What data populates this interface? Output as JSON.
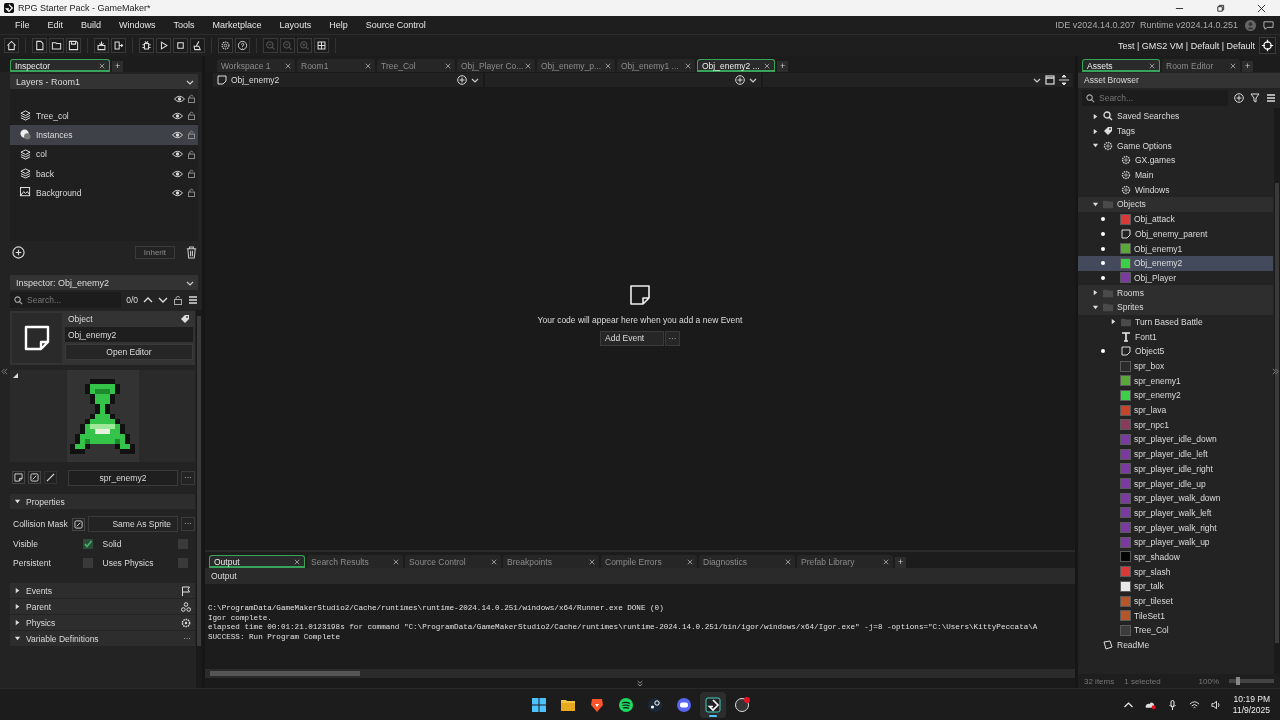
{
  "window": {
    "title": "RPG Starter Pack - GameMaker*"
  },
  "menu": [
    "File",
    "Edit",
    "Build",
    "Windows",
    "Tools",
    "Marketplace",
    "Layouts",
    "Help",
    "Source Control"
  ],
  "ide_version": "IDE v2024.14.0.207",
  "runtime_version": "Runtime v2024.14.0.251",
  "toolbar": [
    [
      {
        "kind": "home",
        "disabled": false
      }
    ],
    [
      {
        "kind": "new",
        "disabled": false
      },
      {
        "kind": "open",
        "disabled": false
      },
      {
        "kind": "save",
        "disabled": false
      }
    ],
    [
      {
        "kind": "package",
        "disabled": false
      },
      {
        "kind": "export",
        "disabled": false
      }
    ],
    [
      {
        "kind": "debug",
        "disabled": false
      },
      {
        "kind": "run",
        "disabled": false
      },
      {
        "kind": "stop",
        "disabled": false
      },
      {
        "kind": "clean",
        "disabled": false
      }
    ],
    [
      {
        "kind": "settings",
        "disabled": false
      },
      {
        "kind": "help",
        "disabled": false
      }
    ],
    [
      {
        "kind": "zoom-out",
        "disabled": true
      },
      {
        "kind": "zoom-reset",
        "disabled": true
      },
      {
        "kind": "zoom-in",
        "disabled": true
      },
      {
        "kind": "grid",
        "disabled": false
      }
    ]
  ],
  "target": "Test | GMS2 VM | Default | Default",
  "inspector": {
    "tabs": [
      {
        "label": "Inspector",
        "selected": true
      }
    ],
    "add_tab": "+",
    "layers_dropdown": "Layers - Room1",
    "layers": [
      {
        "name": "Tree_col",
        "kind": "tiles",
        "selected": false,
        "visible": true
      },
      {
        "name": "Instances",
        "kind": "instances",
        "selected": true,
        "visible": true
      },
      {
        "name": "col",
        "kind": "tiles",
        "selected": false,
        "visible": true
      },
      {
        "name": "back",
        "kind": "tiles",
        "selected": false,
        "visible": true
      },
      {
        "name": "Background",
        "kind": "background",
        "selected": false,
        "visible": true
      }
    ],
    "inherit_button": {
      "label": "Inherit",
      "disabled": true
    },
    "inspector_dropdown": "Inspector: Obj_enemy2",
    "search": {
      "placeholder": "Search..."
    },
    "match_count": "0/0",
    "object": {
      "type_label": "Object",
      "name": "Obj_enemy2",
      "open_button": "Open Editor"
    },
    "sprite_name": "spr_enemy2",
    "sprite_more": "···",
    "properties": {
      "title": "Properties",
      "expanded": true
    },
    "collision_mask": {
      "label": "Collision Mask",
      "value": "Same As Sprite",
      "more": "···"
    },
    "checkboxes": [
      {
        "label": "Visible",
        "checked": true
      },
      {
        "label": "Solid",
        "checked": false
      },
      {
        "label": "Persistent",
        "checked": false
      },
      {
        "label": "Uses Physics",
        "checked": false
      }
    ],
    "sections": [
      {
        "title": "Events",
        "expanded": false,
        "kind": "flag"
      },
      {
        "title": "Parent",
        "expanded": false,
        "kind": "parent"
      },
      {
        "title": "Physics",
        "expanded": false,
        "kind": "physics"
      },
      {
        "title": "Variable Definitions",
        "expanded": true,
        "kind": "more",
        "more": "···"
      }
    ]
  },
  "editor": {
    "tabs": [
      {
        "label": "Workspace 1",
        "selected": false
      },
      {
        "label": "Room1",
        "selected": false
      },
      {
        "label": "Tree_Col",
        "selected": false
      },
      {
        "label": "Obj_Player Co...",
        "selected": false
      },
      {
        "label": "Obj_enemy_p...",
        "selected": false
      },
      {
        "label": "Obj_enemy1 ...",
        "selected": false
      },
      {
        "label": "Obj_enemy2 ...",
        "selected": true
      }
    ],
    "add_tab": "+",
    "breadcrumb": "Obj_enemy2",
    "empty_message": "Your code will appear here when you add a new Event",
    "add_event": "Add Event",
    "add_event_more": "···"
  },
  "output": {
    "tabs": [
      {
        "label": "Output",
        "selected": true
      },
      {
        "label": "Search Results",
        "selected": false
      },
      {
        "label": "Source Control",
        "selected": false
      },
      {
        "label": "Breakpoints",
        "selected": false
      },
      {
        "label": "Compile Errors",
        "selected": false
      },
      {
        "label": "Diagnostics",
        "selected": false
      },
      {
        "label": "Prefab Library",
        "selected": false
      }
    ],
    "add_tab": "+",
    "header": "Output",
    "lines": [
      "C:\\ProgramData/GameMakerStudio2/Cache/runtimes\\runtime-2024.14.0.251/windows/x64/Runner.exe DONE (0)",
      "Igor complete.",
      "elapsed time 00:01:21.0123198s for command \"C:\\ProgramData/GameMakerStudio2/Cache/runtimes\\runtime-2024.14.0.251/bin/igor/windows/x64/Igor.exe\" -j=8  -options=\"C:\\Users\\KittyPeccata\\A",
      "SUCCESS: Run Program Complete"
    ]
  },
  "assets": {
    "tabs": [
      {
        "label": "Assets",
        "selected": true
      },
      {
        "label": "Room Editor",
        "selected": false
      }
    ],
    "add_tab": "+",
    "header": "Asset Browser",
    "search": {
      "placeholder": "Search..."
    },
    "tree": [
      {
        "label": "Saved Searches",
        "kind": "search",
        "expanded": false,
        "selected": false,
        "dot": false
      },
      {
        "label": "Tags",
        "kind": "tag",
        "expanded": false,
        "selected": false,
        "dot": false
      },
      {
        "label": "Game Options",
        "kind": "gear",
        "expanded": true,
        "selected": false,
        "dot": false,
        "children": [
          {
            "label": "GX.games",
            "kind": "gear",
            "selected": false,
            "dot": false
          },
          {
            "label": "Main",
            "kind": "gear",
            "selected": false,
            "dot": false
          },
          {
            "label": "Windows",
            "kind": "gear",
            "selected": false,
            "dot": false
          }
        ]
      },
      {
        "label": "Objects",
        "kind": "folder",
        "expanded": true,
        "selected": false,
        "dot": false,
        "children": [
          {
            "label": "Obj_attack",
            "kind": "thumb",
            "color": "#d83a3a",
            "selected": false,
            "dot": true
          },
          {
            "label": "Obj_enemy_parent",
            "kind": "object",
            "selected": false,
            "dot": true
          },
          {
            "label": "Obj_enemy1",
            "kind": "thumb",
            "color": "#5aa83a",
            "selected": false,
            "dot": true
          },
          {
            "label": "Obj_enemy2",
            "kind": "thumb",
            "color": "#3ecf4a",
            "selected": true,
            "dot": true
          },
          {
            "label": "Obj_Player",
            "kind": "thumb",
            "color": "#7a3aa0",
            "selected": false,
            "dot": true
          }
        ]
      },
      {
        "label": "Rooms",
        "kind": "folder",
        "expanded": false,
        "selected": false,
        "dot": false
      },
      {
        "label": "Sprites",
        "kind": "folder",
        "expanded": true,
        "selected": false,
        "dot": false,
        "children": [
          {
            "label": "Turn Based Battle",
            "kind": "folder",
            "expanded": false,
            "selected": false,
            "dot": false
          },
          {
            "label": "Font1",
            "kind": "font",
            "selected": false,
            "dot": false
          },
          {
            "label": "Object5",
            "kind": "object",
            "selected": false,
            "dot": true
          },
          {
            "label": "spr_box",
            "kind": "thumb",
            "color": "#2b2b2b",
            "selected": false,
            "dot": false
          },
          {
            "label": "spr_enemy1",
            "kind": "thumb",
            "color": "#5aa83a",
            "selected": false,
            "dot": false
          },
          {
            "label": "spr_enemy2",
            "kind": "thumb",
            "color": "#3ecf4a",
            "selected": false,
            "dot": false
          },
          {
            "label": "spr_lava",
            "kind": "thumb",
            "color": "#c4452a",
            "selected": false,
            "dot": false
          },
          {
            "label": "spr_npc1",
            "kind": "thumb",
            "color": "#8a3a5a",
            "selected": false,
            "dot": false
          },
          {
            "label": "spr_player_idle_down",
            "kind": "thumb",
            "color": "#7a3aa0",
            "selected": false,
            "dot": false
          },
          {
            "label": "spr_player_idle_left",
            "kind": "thumb",
            "color": "#7a3aa0",
            "selected": false,
            "dot": false
          },
          {
            "label": "spr_player_idle_right",
            "kind": "thumb",
            "color": "#7a3aa0",
            "selected": false,
            "dot": false
          },
          {
            "label": "spr_player_idle_up",
            "kind": "thumb",
            "color": "#7a3aa0",
            "selected": false,
            "dot": false
          },
          {
            "label": "spr_player_walk_down",
            "kind": "thumb",
            "color": "#7a3aa0",
            "selected": false,
            "dot": false
          },
          {
            "label": "spr_player_walk_left",
            "kind": "thumb",
            "color": "#7a3aa0",
            "selected": false,
            "dot": false
          },
          {
            "label": "spr_player_walk_right",
            "kind": "thumb",
            "color": "#7a3aa0",
            "selected": false,
            "dot": false
          },
          {
            "label": "spr_player_walk_up",
            "kind": "thumb",
            "color": "#7a3aa0",
            "selected": false,
            "dot": false
          },
          {
            "label": "spr_shadow",
            "kind": "thumb",
            "color": "#050505",
            "selected": false,
            "dot": false
          },
          {
            "label": "spr_slash",
            "kind": "thumb",
            "color": "#d83a3a",
            "selected": false,
            "dot": false
          },
          {
            "label": "spr_talk",
            "kind": "thumb",
            "color": "#e8e8e8",
            "selected": false,
            "dot": false
          },
          {
            "label": "spr_tileset",
            "kind": "thumb",
            "color": "#b4552a",
            "selected": false,
            "dot": false
          },
          {
            "label": "TileSet1",
            "kind": "thumb",
            "color": "#b4552a",
            "selected": false,
            "dot": false
          },
          {
            "label": "Tree_Col",
            "kind": "thumb",
            "color": "#3c3c3c",
            "selected": false,
            "dot": false
          }
        ]
      },
      {
        "label": "ReadMe",
        "kind": "note",
        "selected": false,
        "dot": false
      }
    ],
    "item_count": "32 items",
    "selected_count": "1 selected",
    "zoom": "100%",
    "zoom_slider": {
      "level": 0.2
    }
  },
  "taskbar": {
    "apps": [
      {
        "kind": "start",
        "selected": false
      },
      {
        "kind": "files",
        "selected": false
      },
      {
        "kind": "browser",
        "selected": false
      },
      {
        "kind": "music",
        "selected": false
      },
      {
        "kind": "store",
        "selected": false
      },
      {
        "kind": "chat",
        "selected": false
      },
      {
        "kind": "gamemaker",
        "selected": true
      },
      {
        "kind": "recorder",
        "selected": false
      }
    ],
    "time": "10:19 PM",
    "date": "11/9/2025"
  }
}
